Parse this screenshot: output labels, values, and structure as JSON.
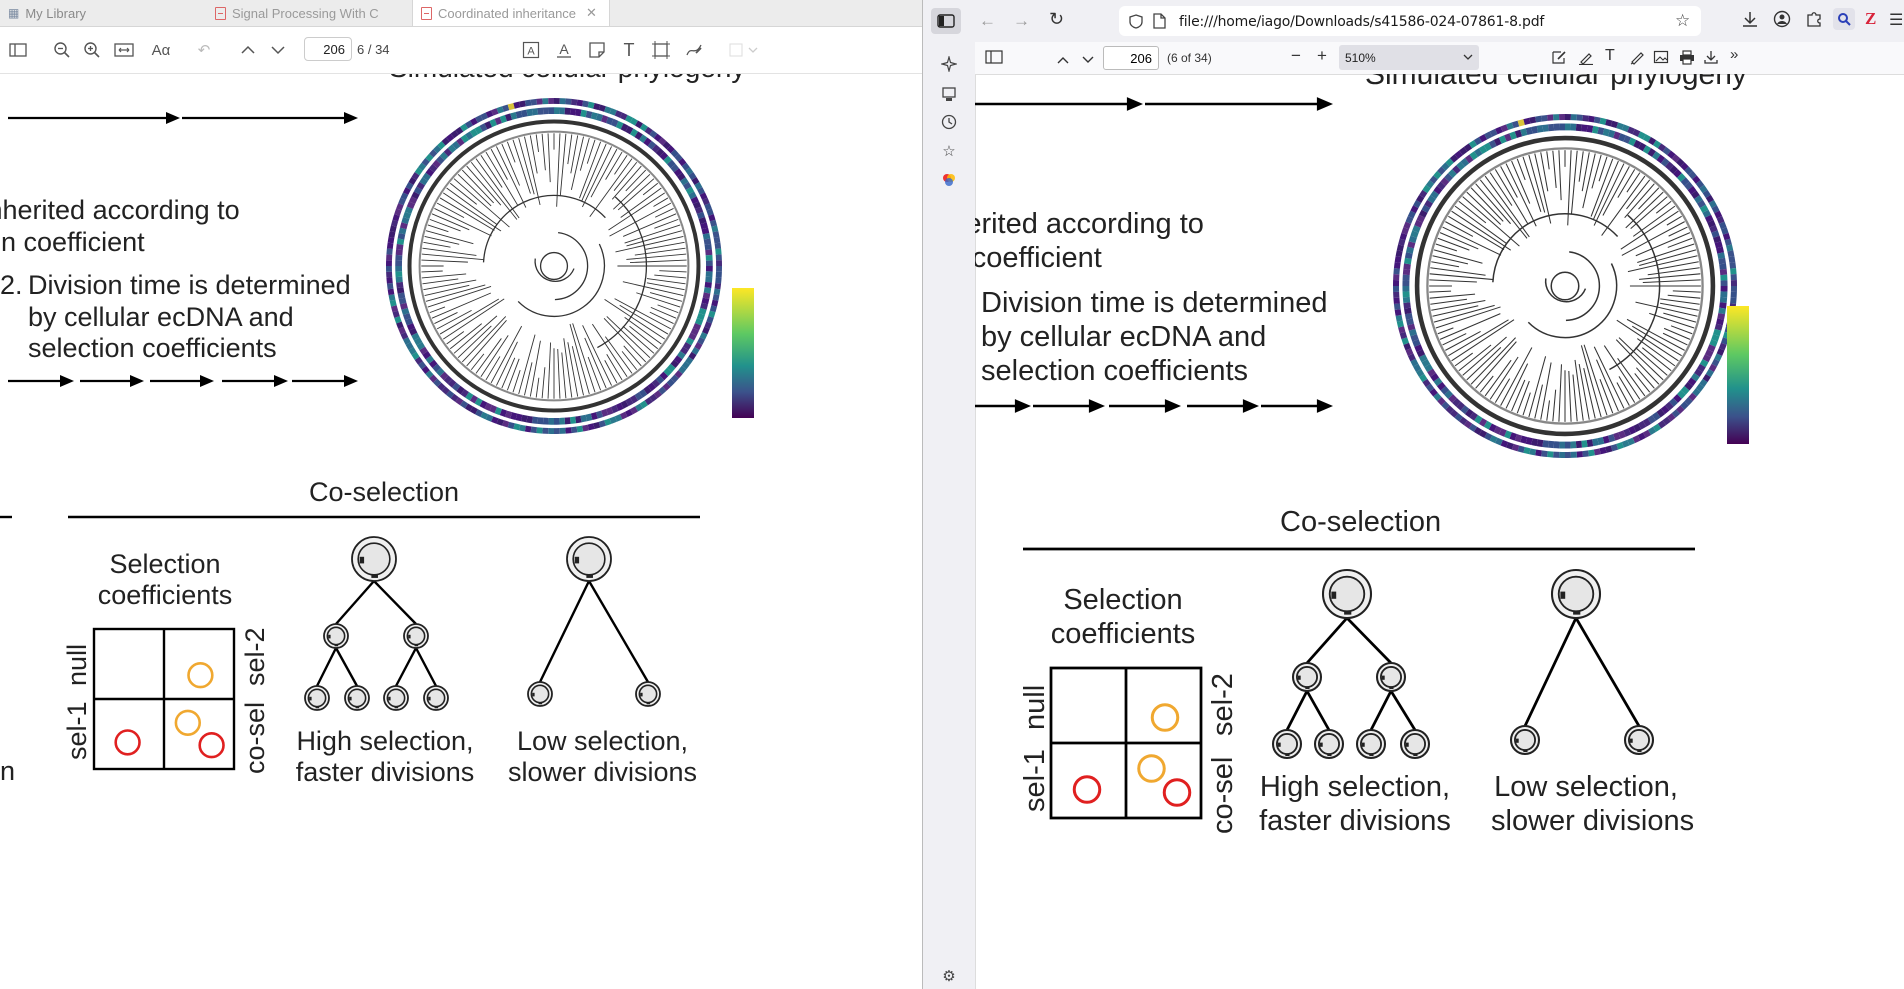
{
  "zotero": {
    "tabs": [
      {
        "label": "My Library",
        "icon": "library-icon"
      },
      {
        "label": "Signal Processing With C",
        "icon": "pdf-icon"
      },
      {
        "label": "Coordinated inheritance",
        "icon": "pdf-icon"
      }
    ],
    "toolbar": {
      "page_value": "206",
      "page_total": "6 / 34",
      "font_label": "Aα"
    }
  },
  "firefox": {
    "url": "file:///home/iago/Downloads/s41586-024-07861-8.pdf",
    "pdf_toolbar": {
      "page_value": "206",
      "page_total": "(6 of 34)",
      "zoom": "510%"
    }
  },
  "figure": {
    "title": "Simulated cellular phylogeny",
    "inherit_line1": "Inherited according to",
    "inherit_line2": "ion coefficient",
    "division_num": "2.",
    "division_line1": "Division time is determined",
    "division_line2": "by cellular ecDNA and",
    "division_line3": "selection coefficients",
    "coselection": "Co-selection",
    "selection_line1": "Selection",
    "selection_line2": "coefficients",
    "label_null": "null",
    "label_sel1": "sel-1",
    "label_sel2": "sel-2",
    "label_cosel": "co-sel",
    "high_line1": "High selection,",
    "high_line2": "faster divisions",
    "low_line1": "Low selection,",
    "low_line2": "slower divisions",
    "stub_left": "n",
    "colors": {
      "orange": "#f0a830",
      "red": "#e02020",
      "ring_dark": "#3b1c6e",
      "ring_mid": "#2b7a8e"
    }
  }
}
